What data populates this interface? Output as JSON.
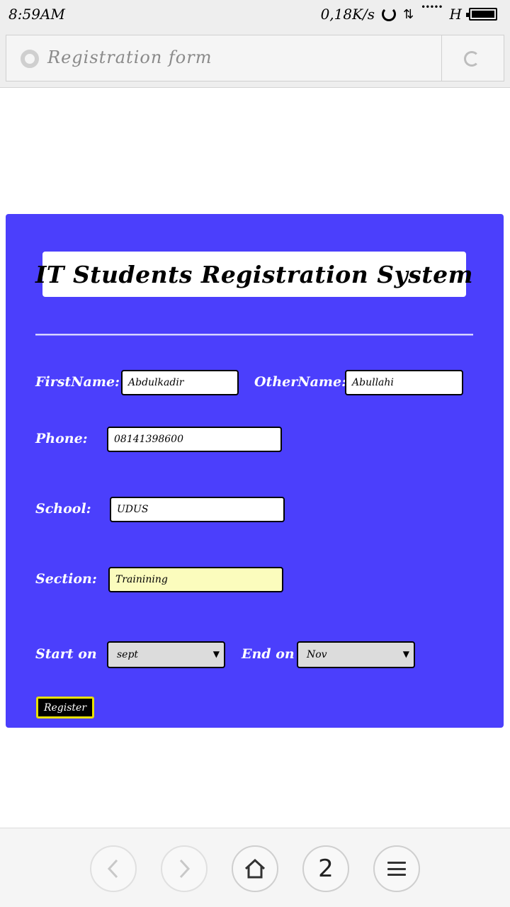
{
  "status_bar": {
    "time": "8:59AM",
    "network_speed": "0,18K/s",
    "signal_type": "H"
  },
  "address_bar": {
    "page_title": "Registration form"
  },
  "form": {
    "title": "IT Students Registration System",
    "fields": {
      "firstname_label": "FirstName:",
      "firstname_value": "Abdulkadir",
      "othername_label": "OtherName:",
      "othername_value": "Abullahi",
      "phone_label": "Phone:",
      "phone_value": "08141398600",
      "school_label": "School:",
      "school_value": "UDUS",
      "section_label": "Section:",
      "section_value": "Trainining",
      "start_label": "Start on",
      "start_value": "sept",
      "end_label": "End on",
      "end_value": "Nov"
    },
    "register_label": "Register"
  },
  "bottom_nav": {
    "tab_count": "2"
  },
  "colors": {
    "panel_background": "#4b3ffc",
    "highlight_field": "#fbfcbd",
    "register_border": "#e8e000"
  },
  "icons": [
    "sync-icon",
    "data-transfer-icon",
    "battery-icon",
    "page-loading-icon",
    "reload-icon",
    "back-icon",
    "forward-icon",
    "home-icon",
    "menu-icon"
  ]
}
